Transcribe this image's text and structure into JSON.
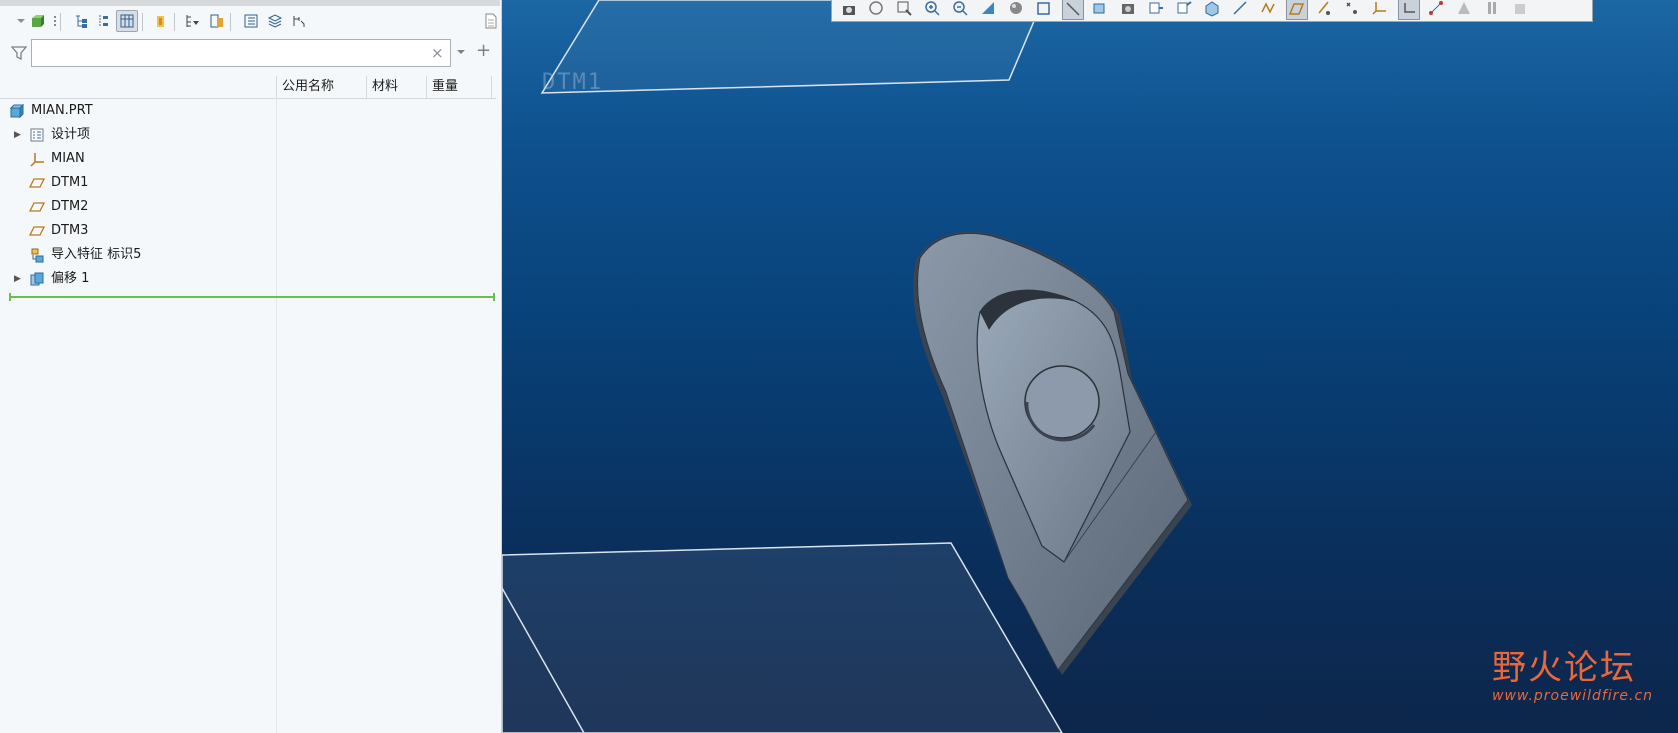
{
  "app": {
    "accent_green": "#6bc04b",
    "viewport_top_color": "#1b67a4",
    "viewport_bottom_color": "#0d264b"
  },
  "model_tree": {
    "toolbar_icons": [
      "part-display-icon",
      "tree-settings-icon",
      "expand-tree-icon",
      "collapse-tree-icon",
      "columns-icon",
      "show-icon",
      "filter-tree-icon",
      "layer-icon",
      "tree-columns-icon",
      "layers-icon",
      "flip-icon",
      "page-icon"
    ],
    "search": {
      "value": "",
      "placeholder": ""
    },
    "columns": {
      "name": "",
      "common_name": "公用名称",
      "material": "材料",
      "weight": "重量"
    },
    "items": [
      {
        "label": "MIAN.PRT",
        "icon": "part-icon",
        "expandable": false
      },
      {
        "label": "设计项",
        "icon": "design-items-icon",
        "expandable": true
      },
      {
        "label": "MIAN",
        "icon": "coordinate-system-icon",
        "expandable": false
      },
      {
        "label": "DTM1",
        "icon": "datum-plane-icon",
        "expandable": false
      },
      {
        "label": "DTM2",
        "icon": "datum-plane-icon",
        "expandable": false
      },
      {
        "label": "DTM3",
        "icon": "datum-plane-icon",
        "expandable": false
      },
      {
        "label": "导入特征 标识5",
        "icon": "import-feature-icon",
        "expandable": false
      },
      {
        "label": "偏移 1",
        "icon": "offset-feature-icon",
        "expandable": true
      }
    ]
  },
  "viewport": {
    "datum_label": "DTM1",
    "graphics_toolbar_icons": [
      "screenshot-icon",
      "refit-icon",
      "zoom-box-icon",
      "zoom-in-icon",
      "zoom-out-icon",
      "repaint-icon",
      "shading-icon",
      "view-orientation-icon",
      "named-view-icon",
      "section-icon",
      "view-manager-icon",
      "display-style-icon",
      "perspective-icon",
      "spin-center-icon",
      "annotation-display-icon",
      "datum-display-icon",
      "plane-display-icon",
      "axis-display-icon",
      "point-display-icon",
      "csys-display-icon",
      "csys-tag-icon",
      "dimension-icon",
      "saved-orientation-icon",
      "pause-icon",
      "extra-icon"
    ]
  },
  "watermark": {
    "cn": "野火论坛",
    "url": "www.proewildfire.cn"
  }
}
